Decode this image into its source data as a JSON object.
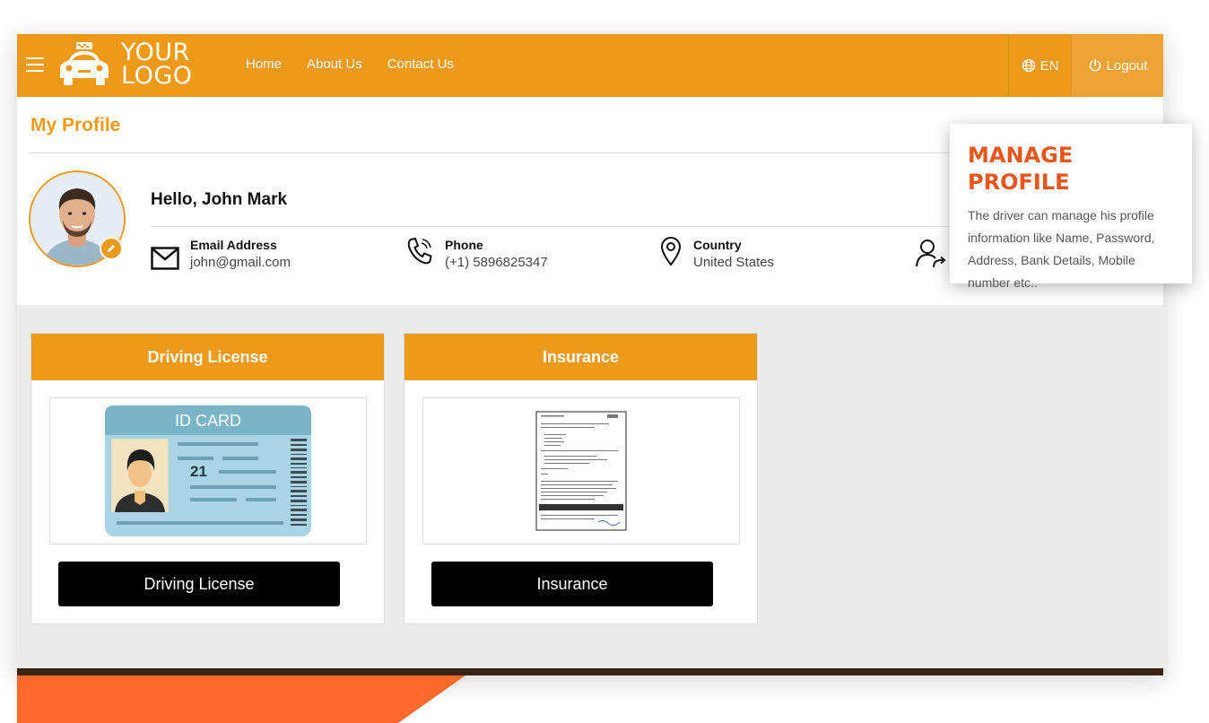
{
  "header": {
    "logo_line1": "YOUR",
    "logo_line2": "LOGO",
    "nav": [
      "Home",
      "About Us",
      "Contact Us"
    ],
    "language": "EN",
    "logout_label": "Logout"
  },
  "profile": {
    "title": "My Profile",
    "greeting": "Hello, John Mark",
    "email_label": "Email Address",
    "email_value": "john@gmail.com",
    "phone_label": "Phone",
    "phone_value": "(+1) 5896825347",
    "country_label": "Country",
    "country_value": "United States"
  },
  "documents": [
    {
      "header": "Driving License",
      "button": "Driving License",
      "id_card_title": "ID CARD",
      "id_card_number": "21"
    },
    {
      "header": "Insurance",
      "button": "Insurance"
    }
  ],
  "callout": {
    "title": "MANAGE PROFILE",
    "body": "The driver can manage his profile information like Name, Password, Address, Bank Details, Mobile number etc.."
  },
  "colors": {
    "accent": "#ee9a19",
    "callout_title": "#e8561c",
    "button": "#000000",
    "footer_strip": "#3a2412",
    "wedge": "#ff6a2b"
  }
}
